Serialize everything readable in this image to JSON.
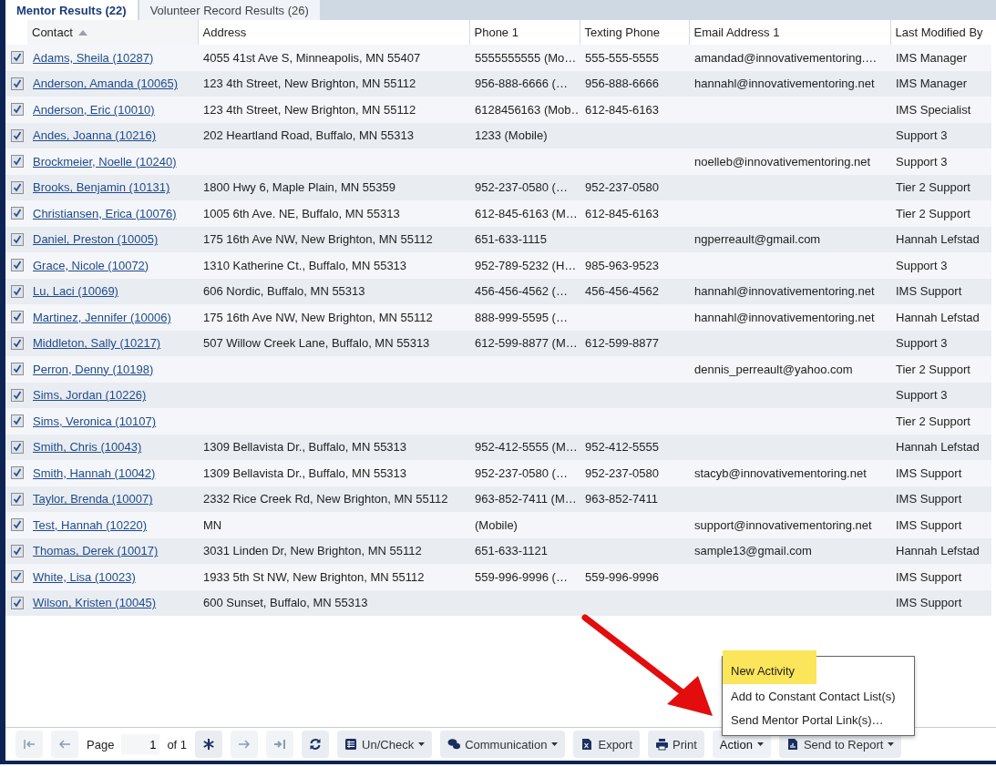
{
  "tabs": [
    {
      "label": "Mentor Results (22)",
      "selected": true
    },
    {
      "label": "Volunteer Record Results (26)",
      "selected": false
    }
  ],
  "table": {
    "columns": [
      {
        "label": "Contact",
        "sorted": true
      },
      {
        "label": "Address",
        "sorted": false
      },
      {
        "label": "Phone 1",
        "sorted": false
      },
      {
        "label": "Texting Phone",
        "sorted": false
      },
      {
        "label": "Email Address 1",
        "sorted": false
      },
      {
        "label": "Last Modified By",
        "sorted": false
      }
    ],
    "rows": [
      {
        "checked": true,
        "contact": "Adams, Sheila (10287)",
        "address": "4055 41st Ave S, Minneapolis, MN 55407",
        "phone": "5555555555 (Mo…",
        "texting": "555-555-5555",
        "email": "amandad@innovativementoring.…",
        "modified_by": "IMS Manager"
      },
      {
        "checked": true,
        "contact": "Anderson, Amanda (10065)",
        "address": "123 4th Street, New Brighton, MN 55112",
        "phone": "956-888-6666 (…",
        "texting": "956-888-6666",
        "email": "hannahl@innovativementoring.net",
        "modified_by": "IMS Manager"
      },
      {
        "checked": true,
        "contact": "Anderson, Eric (10010)",
        "address": "123 4th Street, New Brighton, MN 55112",
        "phone": "6128456163 (Mob…",
        "texting": "612-845-6163",
        "modified_by": "IMS Specialist"
      },
      {
        "checked": true,
        "contact": "Andes, Joanna (10216)",
        "address": "202 Heartland Road, Buffalo, MN 55313",
        "phone": "1233 (Mobile)",
        "modified_by": "Support 3"
      },
      {
        "checked": true,
        "contact": "Brockmeier, Noelle (10240)",
        "email": "noelleb@innovativementoring.net",
        "modified_by": "Support 3"
      },
      {
        "checked": true,
        "contact": "Brooks, Benjamin (10131)",
        "address": "1800 Hwy 6, Maple Plain, MN 55359",
        "phone": "952-237-0580 (…",
        "texting": "952-237-0580",
        "modified_by": "Tier 2 Support"
      },
      {
        "checked": true,
        "contact": "Christiansen, Erica (10076)",
        "address": "1005 6th Ave. NE, Buffalo, MN 55313",
        "phone": "612-845-6163 (M…",
        "texting": "612-845-6163",
        "modified_by": "Tier 2 Support"
      },
      {
        "checked": true,
        "contact": "Daniel, Preston (10005)",
        "address": "175 16th Ave NW, New Brighton, MN 55112",
        "phone": "651-633-1115",
        "email": "ngperreault@gmail.com",
        "modified_by": "Hannah Lefstad"
      },
      {
        "checked": true,
        "contact": "Grace, Nicole (10072)",
        "address": "1310 Katherine Ct., Buffalo, MN 55313",
        "phone": "952-789-5232 (H…",
        "texting": "985-963-9523",
        "modified_by": "Support 3"
      },
      {
        "checked": true,
        "contact": "Lu, Laci (10069)",
        "address": "606 Nordic, Buffalo, MN 55313",
        "phone": "456-456-4562 (…",
        "texting": "456-456-4562",
        "email": "hannahl@innovativementoring.net",
        "modified_by": "IMS Support"
      },
      {
        "checked": true,
        "contact": "Martinez, Jennifer (10006)",
        "address": "175 16th Ave NW, New Brighton, MN 55112",
        "phone": "888-999-5595 (…",
        "email": "hannahl@innovativementoring.net",
        "modified_by": "Hannah Lefstad"
      },
      {
        "checked": true,
        "contact": "Middleton, Sally (10217)",
        "address": "507 Willow Creek Lane, Buffalo, MN 55313",
        "phone": "612-599-8877 (M…",
        "texting": "612-599-8877",
        "modified_by": "Support 3"
      },
      {
        "checked": true,
        "contact": "Perron, Denny (10198)",
        "email": "dennis_perreault@yahoo.com",
        "modified_by": "Tier 2 Support"
      },
      {
        "checked": true,
        "contact": "Sims, Jordan (10226)",
        "modified_by": "Support 3"
      },
      {
        "checked": true,
        "contact": "Sims, Veronica (10107)",
        "modified_by": "Tier 2 Support"
      },
      {
        "checked": true,
        "contact": "Smith, Chris (10043)",
        "address": "1309 Bellavista Dr., Buffalo, MN 55313",
        "phone": "952-412-5555 (M…",
        "texting": "952-412-5555",
        "modified_by": "Hannah Lefstad"
      },
      {
        "checked": true,
        "contact": "Smith, Hannah (10042)",
        "address": "1309 Bellavista Dr., Buffalo, MN 55313",
        "phone": "952-237-0580 (…",
        "texting": "952-237-0580",
        "email": "stacyb@innovativementoring.net",
        "modified_by": "IMS Support"
      },
      {
        "checked": true,
        "contact": "Taylor, Brenda (10007)",
        "address": "2332 Rice Creek Rd, New Brighton, MN 55112",
        "phone": "963-852-7411 (M…",
        "texting": "963-852-7411",
        "modified_by": "IMS Support"
      },
      {
        "checked": true,
        "contact": "Test, Hannah (10220)",
        "address": "MN",
        "phone": "(Mobile)",
        "email": "support@innovativementoring.net",
        "modified_by": "IMS Support"
      },
      {
        "checked": true,
        "contact": "Thomas, Derek (10017)",
        "address": "3031 Linden Dr, New Brighton, MN 55112",
        "phone": "651-633-1121",
        "email": "sample13@gmail.com",
        "modified_by": "Hannah Lefstad"
      },
      {
        "checked": true,
        "contact": "White, Lisa (10023)",
        "address": "1933 5th St NW, New Brighton, MN 55112",
        "phone": "559-996-9996 (…",
        "texting": "559-996-9996",
        "modified_by": "IMS Support"
      },
      {
        "checked": true,
        "contact": "Wilson, Kristen (10045)",
        "address": "600 Sunset, Buffalo, MN 55313",
        "modified_by": "IMS Support"
      }
    ]
  },
  "action_menu": {
    "items": [
      {
        "label": "New Activity",
        "selected": true
      },
      {
        "label": "Add to Constant Contact List(s)",
        "selected": false
      },
      {
        "label": "Send Mentor Portal Link(s)…",
        "selected": false
      }
    ]
  },
  "toolbar": [
    {
      "kind": "first",
      "disabled": true
    },
    {
      "kind": "prev",
      "disabled": true
    },
    {
      "kind": "pager",
      "label": "Page",
      "value": "1",
      "total": "of 1"
    },
    {
      "kind": "asterisk"
    },
    {
      "kind": "next",
      "disabled": true
    },
    {
      "kind": "last",
      "disabled": true
    },
    {
      "kind": "refresh"
    },
    {
      "kind": "list",
      "label": "Un/Check",
      "dropdown": true
    },
    {
      "kind": "chat",
      "label": "Communication",
      "dropdown": true
    },
    {
      "kind": "excel",
      "label": "Export",
      "dropdown": false
    },
    {
      "kind": "print",
      "label": "Print",
      "dropdown": false
    },
    {
      "kind": "plain",
      "label": "Action",
      "dropdown": true,
      "open": true
    },
    {
      "kind": "report",
      "label": "Send to Report",
      "dropdown": true
    }
  ]
}
